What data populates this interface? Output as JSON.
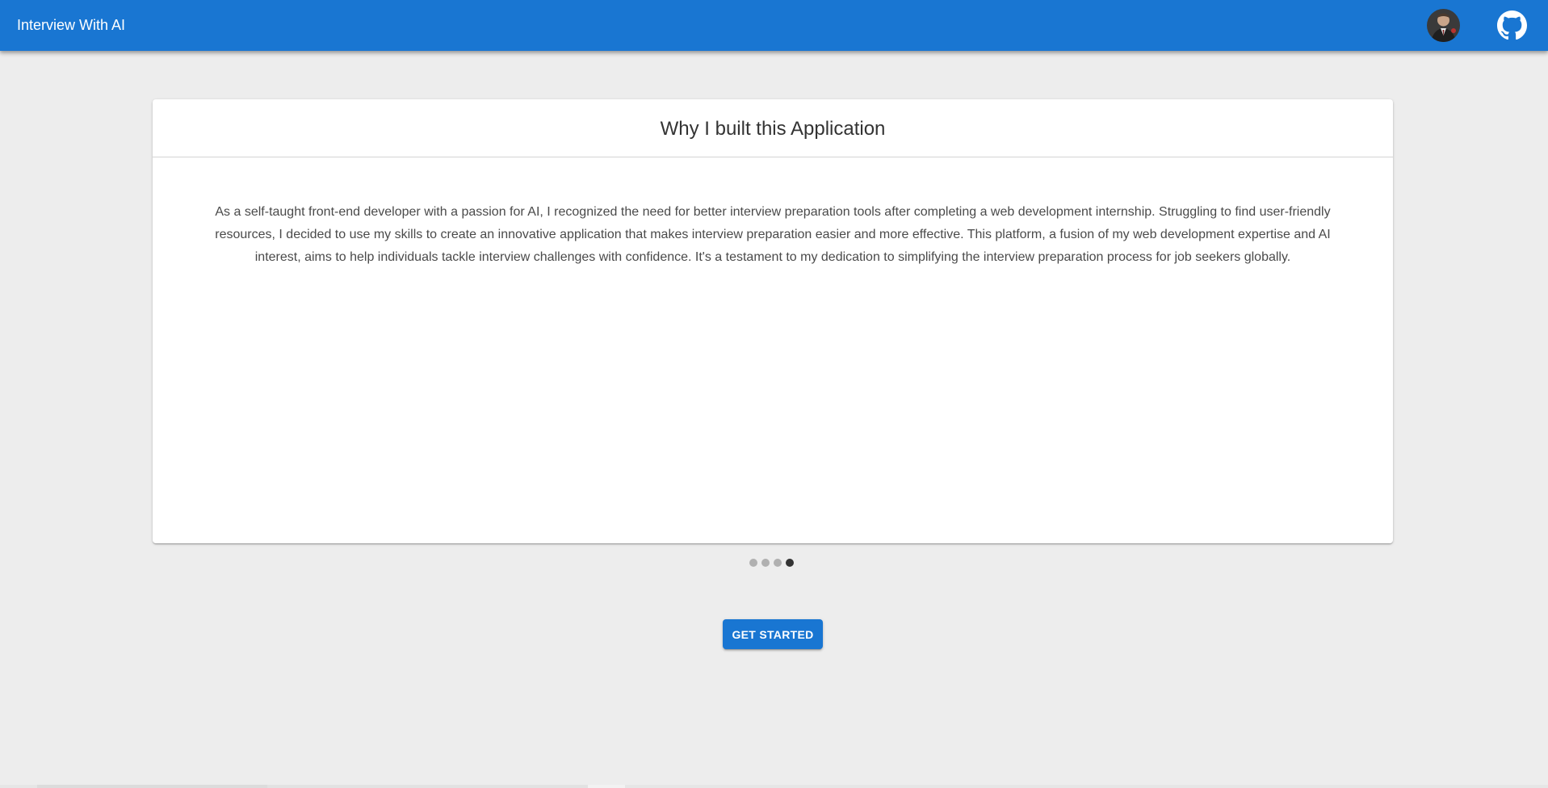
{
  "appbar": {
    "title": "Interview With AI",
    "avatar_icon": "avatar-photo",
    "github_icon": "github-icon",
    "color": "#1976d2"
  },
  "card": {
    "title": "Why I built this Application",
    "text": "As a self-taught front-end developer with a passion for AI, I recognized the need for better interview preparation tools after completing a web development internship. Struggling to find user-friendly resources, I decided to use my skills to create an innovative application that makes interview preparation easier and more effective. This platform, a fusion of my web development expertise and AI interest, aims to help individuals tackle interview challenges with confidence. It's a testament to my dedication to simplifying the interview preparation process for job seekers globally."
  },
  "carousel": {
    "slide_count": 4,
    "active_index": 3
  },
  "actions": {
    "get_started_label": "GET STARTED"
  }
}
